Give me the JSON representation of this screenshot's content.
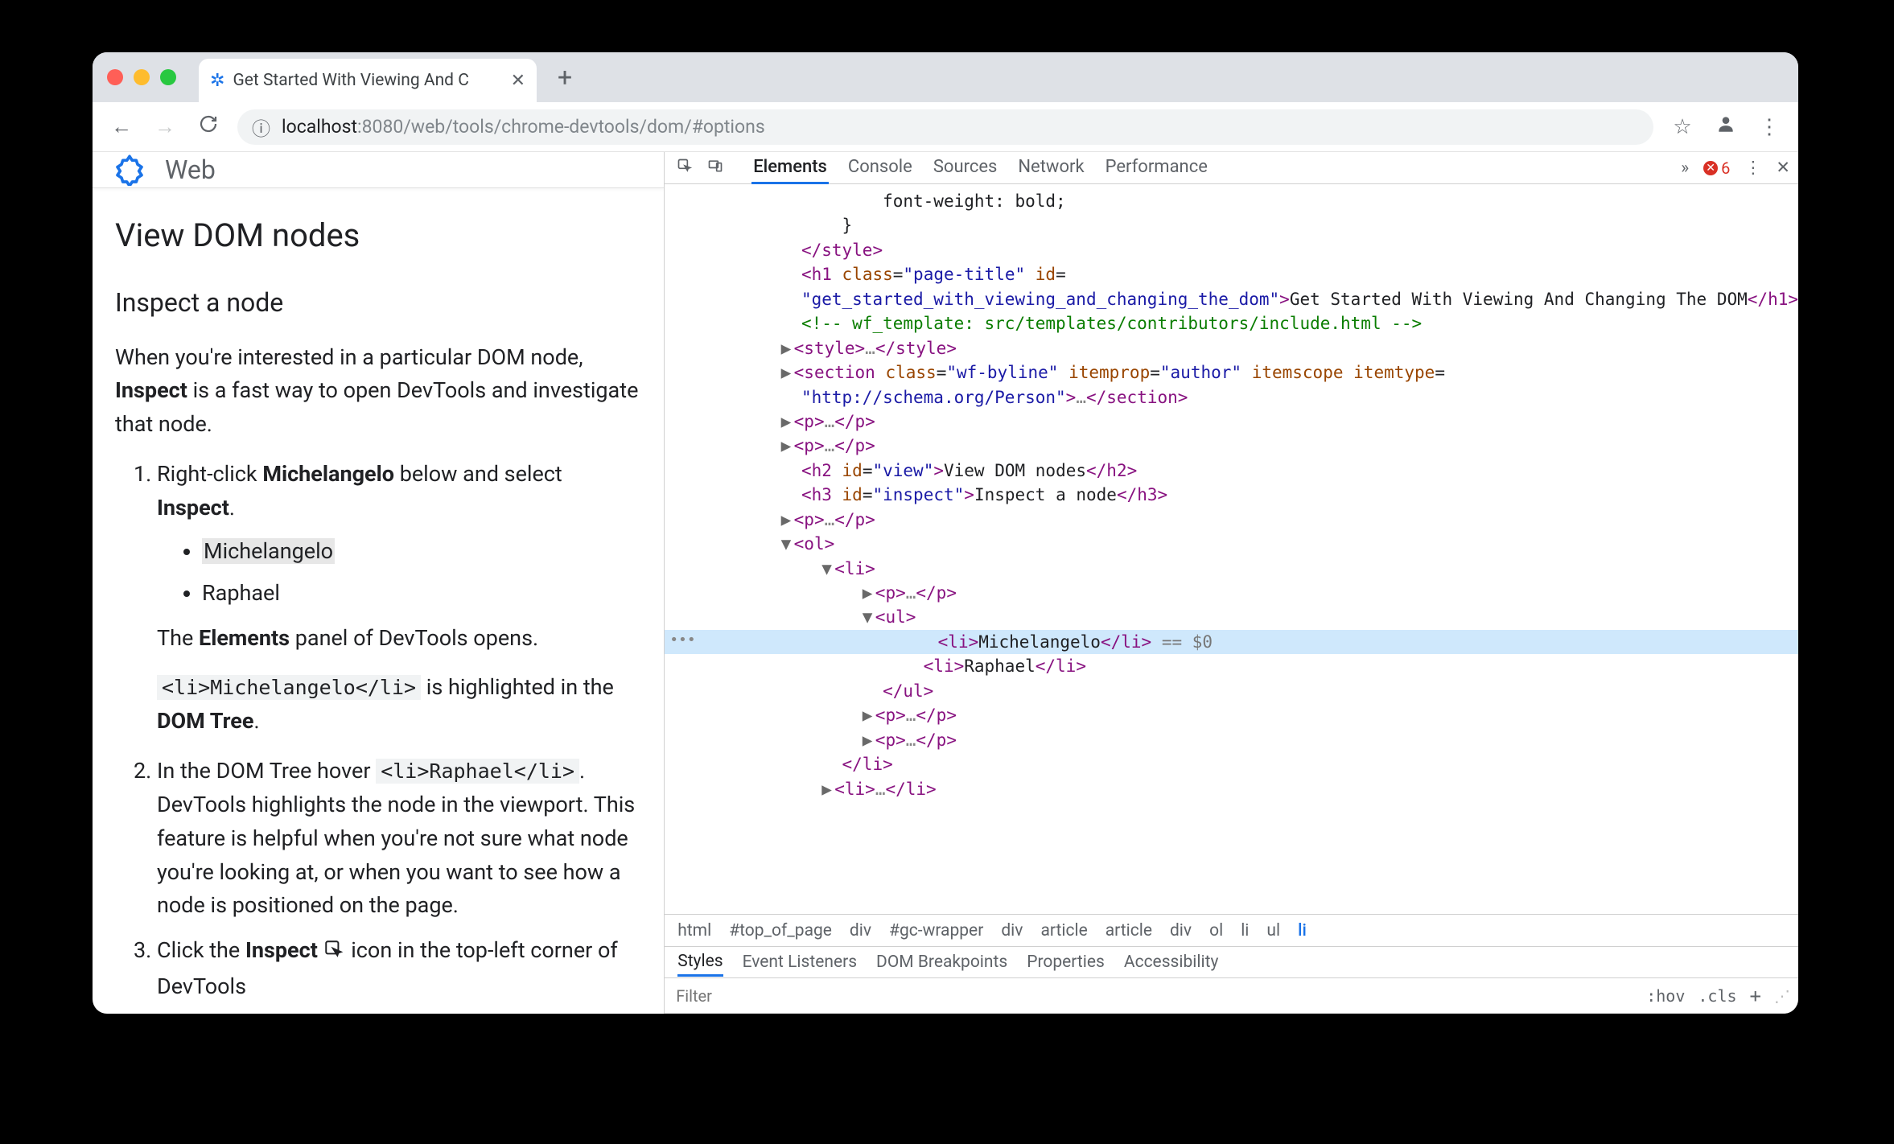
{
  "browser": {
    "tab_title": "Get Started With Viewing And C",
    "url_prefix": "localhost",
    "url_suffix": ":8080/web/tools/chrome-devtools/dom/#options",
    "nav": {
      "back": "←",
      "forward": "→",
      "reload": "⟳"
    }
  },
  "page": {
    "site_name": "Web",
    "h2": "View DOM nodes",
    "h3": "Inspect a node",
    "intro_pre": "When you're interested in a particular DOM node, ",
    "intro_bold": "Inspect",
    "intro_post": " is a fast way to open DevTools and investigate that node.",
    "step1_a": "Right-click ",
    "step1_b": "Michelangelo",
    "step1_c": " below and select ",
    "step1_d": "Inspect",
    "step1_e": ".",
    "li1": "Michelangelo",
    "li2": "Raphael",
    "elements_line_a": "The ",
    "elements_line_b": "Elements",
    "elements_line_c": " panel of DevTools opens.",
    "code_li": "<li>Michelangelo</li>",
    "highlighted_a": " is highlighted in the ",
    "highlighted_b": "DOM Tree",
    "highlighted_c": ".",
    "step2_a": "In the DOM Tree hover ",
    "step2_code": "<li>Raphael</li>",
    "step2_b": ". DevTools highlights the node in the viewport. This feature is helpful when you're not sure what node you're looking at, or when you want to see how a node is positioned on the page.",
    "step3_a": "Click the ",
    "step3_b": "Inspect",
    "step3_c": " icon in the top-left corner of DevTools"
  },
  "devtools": {
    "panels": [
      "Elements",
      "Console",
      "Sources",
      "Network",
      "Performance"
    ],
    "more_chevron": "»",
    "errors": "6",
    "dom_lines": [
      {
        "indent": 10,
        "type": "text",
        "txt": "font-weight: bold;"
      },
      {
        "indent": 8,
        "type": "text",
        "txt": "}"
      },
      {
        "indent": 6,
        "type": "close",
        "tag": "style"
      },
      {
        "indent": 6,
        "type": "h1"
      },
      {
        "indent": 6,
        "type": "h1_txt"
      },
      {
        "indent": 6,
        "type": "comment",
        "txt": "<!-- wf_template: src/templates/contributors/include.html -->"
      },
      {
        "indent": 6,
        "type": "collapsed",
        "arrow": "▶",
        "tag": "style",
        "ell": true
      },
      {
        "indent": 6,
        "type": "section"
      },
      {
        "indent": 6,
        "type": "section_close"
      },
      {
        "indent": 6,
        "type": "collapsed",
        "arrow": "▶",
        "tag": "p",
        "ell": true
      },
      {
        "indent": 6,
        "type": "collapsed",
        "arrow": "▶",
        "tag": "p",
        "ell": true
      },
      {
        "indent": 6,
        "type": "h2"
      },
      {
        "indent": 6,
        "type": "h3"
      },
      {
        "indent": 6,
        "type": "collapsed",
        "arrow": "▶",
        "tag": "p",
        "ell": true
      },
      {
        "indent": 6,
        "type": "open",
        "arrow": "▼",
        "tag": "ol"
      },
      {
        "indent": 8,
        "type": "open",
        "arrow": "▼",
        "tag": "li"
      },
      {
        "indent": 10,
        "type": "collapsed",
        "arrow": "▶",
        "tag": "p",
        "ell": true
      },
      {
        "indent": 10,
        "type": "open",
        "arrow": "▼",
        "tag": "ul"
      },
      {
        "indent": 12,
        "type": "selected"
      },
      {
        "indent": 12,
        "type": "li_raphael"
      },
      {
        "indent": 10,
        "type": "close",
        "tag": "ul"
      },
      {
        "indent": 10,
        "type": "collapsed",
        "arrow": "▶",
        "tag": "p",
        "ell": true
      },
      {
        "indent": 10,
        "type": "collapsed",
        "arrow": "▶",
        "tag": "p",
        "ell": true
      },
      {
        "indent": 8,
        "type": "close",
        "tag": "li"
      },
      {
        "indent": 8,
        "type": "collapsed",
        "arrow": "▶",
        "tag": "li",
        "ell": true
      }
    ],
    "h1": {
      "class": "page-title",
      "id": "get_started_with_viewing_and_changing_the_dom",
      "text": "Get Started With Viewing And Changing The DOM"
    },
    "section": {
      "class": "wf-byline",
      "itemprop": "author",
      "itemtype": "http://schema.org/Person"
    },
    "h2": {
      "id": "view",
      "text": "View DOM nodes"
    },
    "h3": {
      "id": "inspect",
      "text": "Inspect a node"
    },
    "selected": {
      "text": "Michelangelo",
      "suffix": " == $0"
    },
    "raphael": "Raphael",
    "breadcrumbs": [
      "html",
      "#top_of_page",
      "div",
      "#gc-wrapper",
      "div",
      "article",
      "article",
      "div",
      "ol",
      "li",
      "ul",
      "li"
    ],
    "styles_tabs": [
      "Styles",
      "Event Listeners",
      "DOM Breakpoints",
      "Properties",
      "Accessibility"
    ],
    "filter_placeholder": "Filter",
    "hov": ":hov",
    "cls": ".cls"
  }
}
